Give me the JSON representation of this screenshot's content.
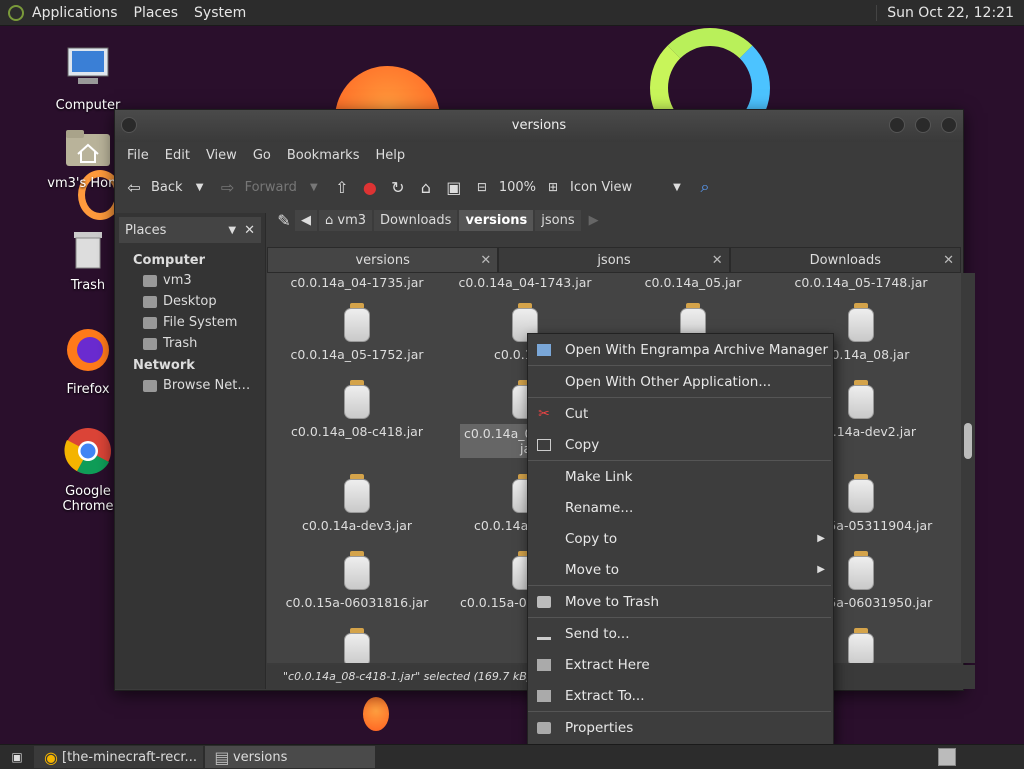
{
  "top_panel": {
    "menus": [
      "Applications",
      "Places",
      "System"
    ],
    "clock": "Sun Oct 22, 12:21"
  },
  "desktop_icons": [
    "Computer",
    "vm3's Home",
    "Trash",
    "Firefox",
    "Google Chrome"
  ],
  "window": {
    "title": "versions",
    "menu": [
      "File",
      "Edit",
      "View",
      "Go",
      "Bookmarks",
      "Help"
    ],
    "toolbar": {
      "back": "Back",
      "forward": "Forward",
      "zoom": "100%",
      "view_mode": "Icon View"
    },
    "breadcrumb": [
      "vm3",
      "Downloads",
      "versions",
      "jsons"
    ],
    "sidebar": {
      "header": "Places",
      "sections": [
        {
          "title": "Computer",
          "items": [
            "vm3",
            "Desktop",
            "File System",
            "Trash"
          ]
        },
        {
          "title": "Network",
          "items": [
            "Browse Net…"
          ]
        }
      ]
    },
    "tabs": [
      "versions",
      "jsons",
      "Downloads"
    ],
    "files": {
      "row0": [
        "c0.0.14a_04-1735.jar",
        "c0.0.14a_04-1743.jar",
        "c0.0.14a_05.jar",
        "c0.0.14a_05-1748.jar"
      ],
      "row1": [
        "c0.0.14a_05-1752.jar",
        "c0.0.14a_0",
        "",
        "c0.0.14a_08.jar"
      ],
      "row2": [
        "c0.0.14a_08-c418.jar",
        "c0.0.14a_0",
        "",
        "c0.0.14a-dev2.jar"
      ],
      "row2_sel_line2": "jar",
      "row3": [
        "c0.0.14a-dev3.jar",
        "c0.0.14a-",
        "",
        "c0.0.15a-05311904.jar"
      ],
      "row4": [
        "c0.0.15a-06031816.jar",
        "c0.0.15a-06",
        "",
        "c0.0.15a-06031950.jar"
      ]
    },
    "status": "\"c0.0.14a_08-c418-1.jar\" selected (169.7 kB), Free"
  },
  "context_menu": [
    "Open With Engrampa Archive Manager",
    "Open With Other Application...",
    "Cut",
    "Copy",
    "Make Link",
    "Rename...",
    "Copy to",
    "Move to",
    "Move to Trash",
    "Send to...",
    "Extract Here",
    "Extract To...",
    "Properties"
  ],
  "taskbar": {
    "tasks": [
      "[the-minecraft-recr...",
      "versions"
    ]
  }
}
